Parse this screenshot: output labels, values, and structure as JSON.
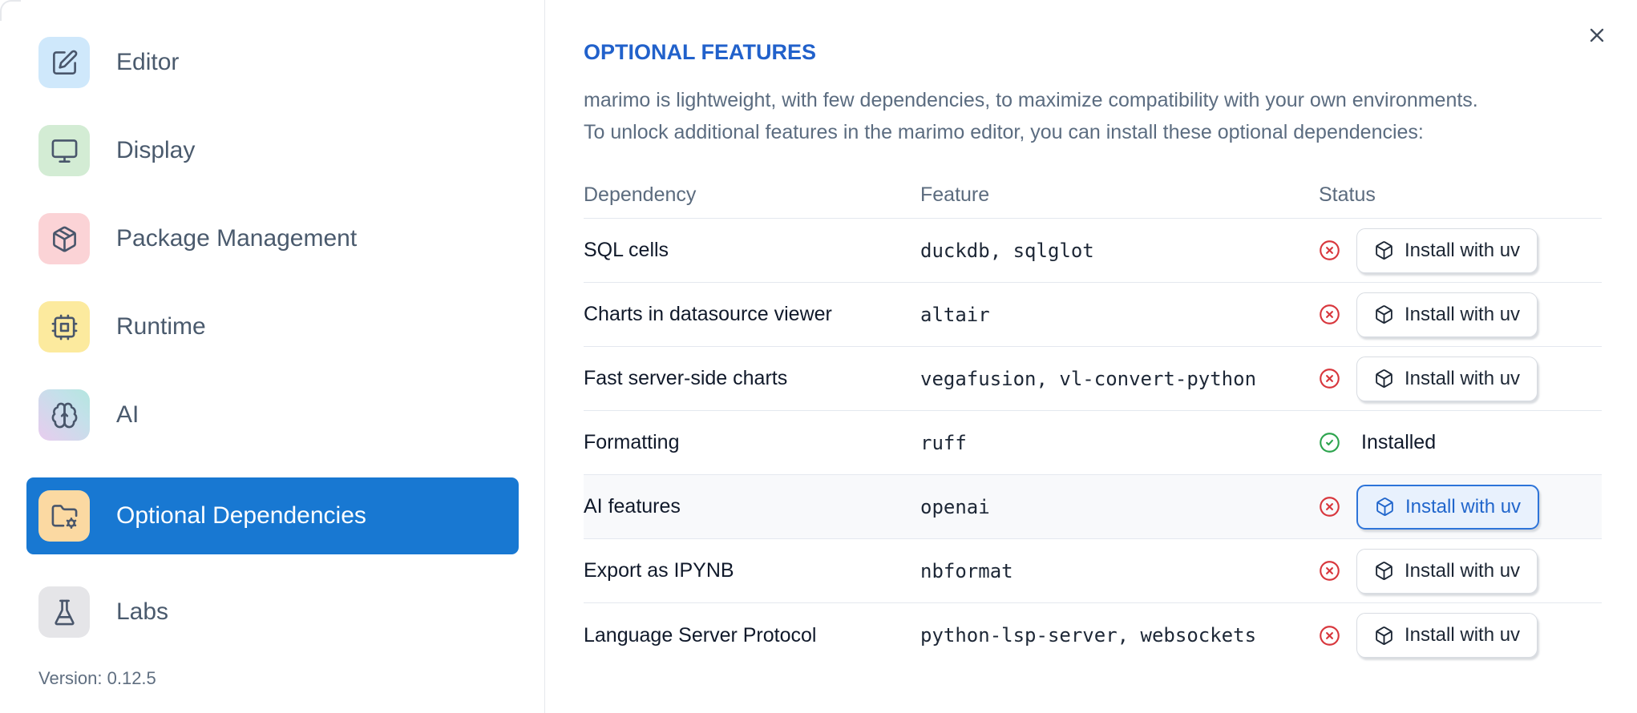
{
  "sidebar": {
    "items": [
      {
        "label": "Editor",
        "icon": "square-pen-icon",
        "icon_bg": "#cfe8fb",
        "selected": false
      },
      {
        "label": "Display",
        "icon": "monitor-icon",
        "icon_bg": "#d3ecd4",
        "selected": false
      },
      {
        "label": "Package Management",
        "icon": "package-icon",
        "icon_bg": "#fbd3d6",
        "selected": false
      },
      {
        "label": "Runtime",
        "icon": "cpu-icon",
        "icon_bg": "#fcea9e",
        "selected": false
      },
      {
        "label": "AI",
        "icon": "brain-icon",
        "icon_bg_from": "#e8ccee",
        "icon_bg_to": "#b4e6df",
        "selected": false
      },
      {
        "label": "Optional Dependencies",
        "icon": "folder-cog-icon",
        "icon_bg": "#fbd9a2",
        "selected": true
      },
      {
        "label": "Labs",
        "icon": "flask-icon",
        "icon_bg": "#e5e5e8",
        "selected": false
      }
    ],
    "version_label": "Version: 0.12.5"
  },
  "main": {
    "title": "OPTIONAL FEATURES",
    "description_lines": [
      "marimo is lightweight, with few dependencies, to maximize compatibility with your own environments.",
      "To unlock additional features in the marimo editor, you can install these optional dependencies:"
    ],
    "close_icon": "x-icon",
    "table": {
      "columns": {
        "dependency": "Dependency",
        "feature": "Feature",
        "status": "Status"
      },
      "rows": [
        {
          "dependency": "SQL cells",
          "feature": "duckdb, sqlglot",
          "status": "missing",
          "action_label": "Install with uv",
          "highlighted": false
        },
        {
          "dependency": "Charts in datasource viewer",
          "feature": "altair",
          "status": "missing",
          "action_label": "Install with uv",
          "highlighted": false
        },
        {
          "dependency": "Fast server-side charts",
          "feature": "vegafusion, vl-convert-python",
          "status": "missing",
          "action_label": "Install with uv",
          "highlighted": false
        },
        {
          "dependency": "Formatting",
          "feature": "ruff",
          "status": "installed",
          "status_label": "Installed",
          "highlighted": false
        },
        {
          "dependency": "AI features",
          "feature": "openai",
          "status": "missing",
          "action_label": "Install with uv",
          "highlighted": true
        },
        {
          "dependency": "Export as IPYNB",
          "feature": "nbformat",
          "status": "missing",
          "action_label": "Install with uv",
          "highlighted": false
        },
        {
          "dependency": "Language Server Protocol",
          "feature": "python-lsp-server, websockets",
          "status": "missing",
          "action_label": "Install with uv",
          "highlighted": false
        }
      ]
    }
  },
  "colors": {
    "selected_item_blue": "#1878d2",
    "title_blue": "#2161cb",
    "error_red": "#d8373d",
    "success_green": "#2da44e",
    "highlight_row_bg": "#f8f9fb",
    "highlight_btn_bg": "#e8f1fd",
    "highlight_btn_border": "#2d74d9",
    "divider": "#e4e8ef"
  }
}
